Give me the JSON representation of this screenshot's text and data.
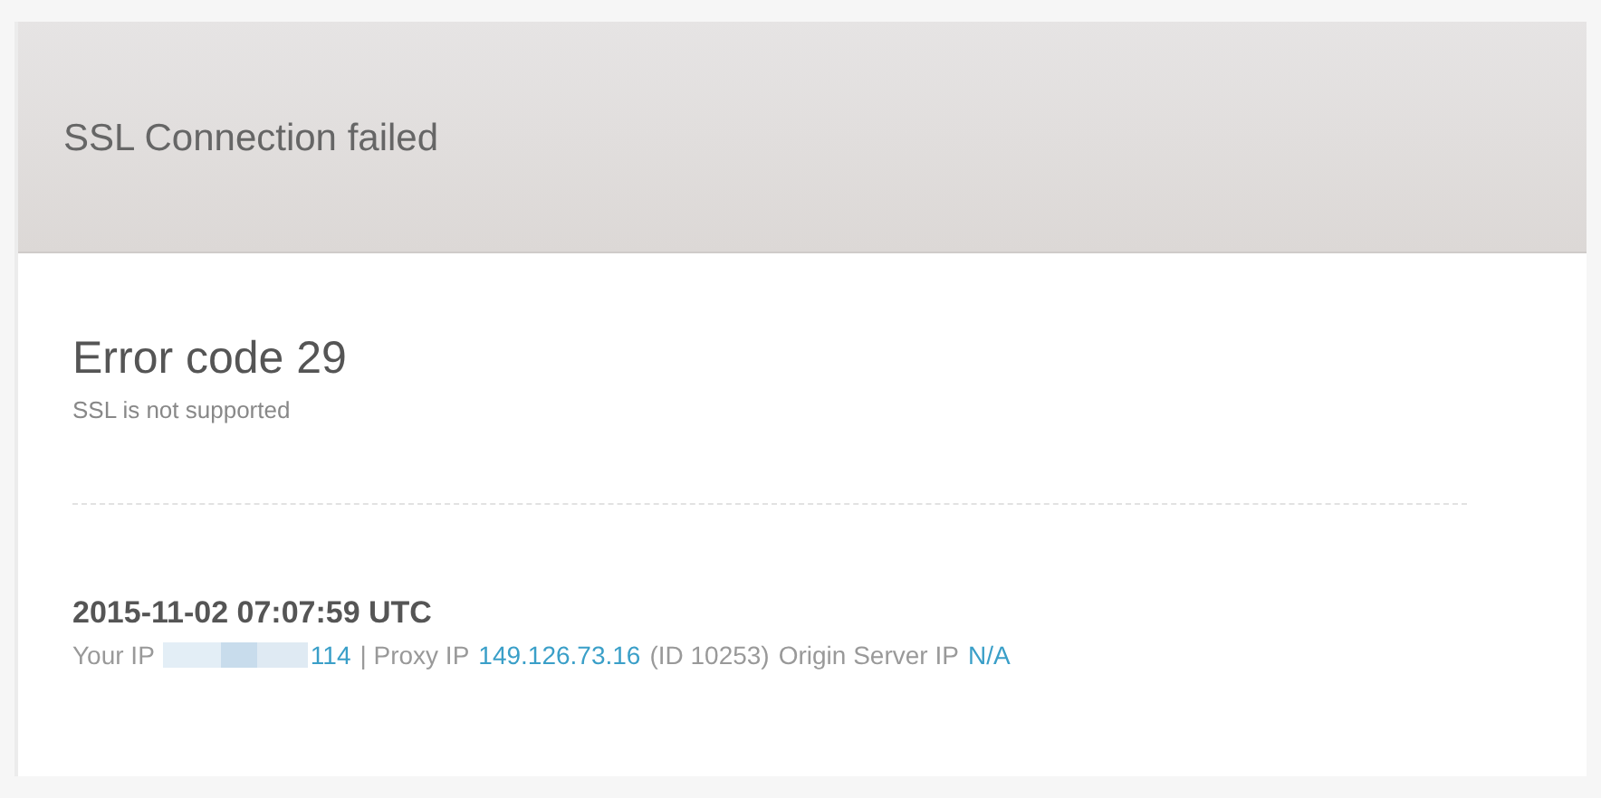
{
  "header": {
    "title": "SSL Connection failed"
  },
  "error": {
    "heading": "Error code 29",
    "description": "SSL is not supported"
  },
  "details": {
    "timestamp": "2015-11-02 07:07:59 UTC",
    "segments": [
      {
        "kind": "text",
        "text": "Your IP"
      },
      {
        "kind": "redacted"
      },
      {
        "kind": "link",
        "text": "114"
      },
      {
        "kind": "text",
        "text": "| Proxy IP"
      },
      {
        "kind": "link",
        "text": "149.126.73.16"
      },
      {
        "kind": "text",
        "text": "(ID 10253)"
      },
      {
        "kind": "text",
        "text": "Origin Server IP"
      },
      {
        "kind": "link",
        "text": "N/A"
      }
    ]
  }
}
